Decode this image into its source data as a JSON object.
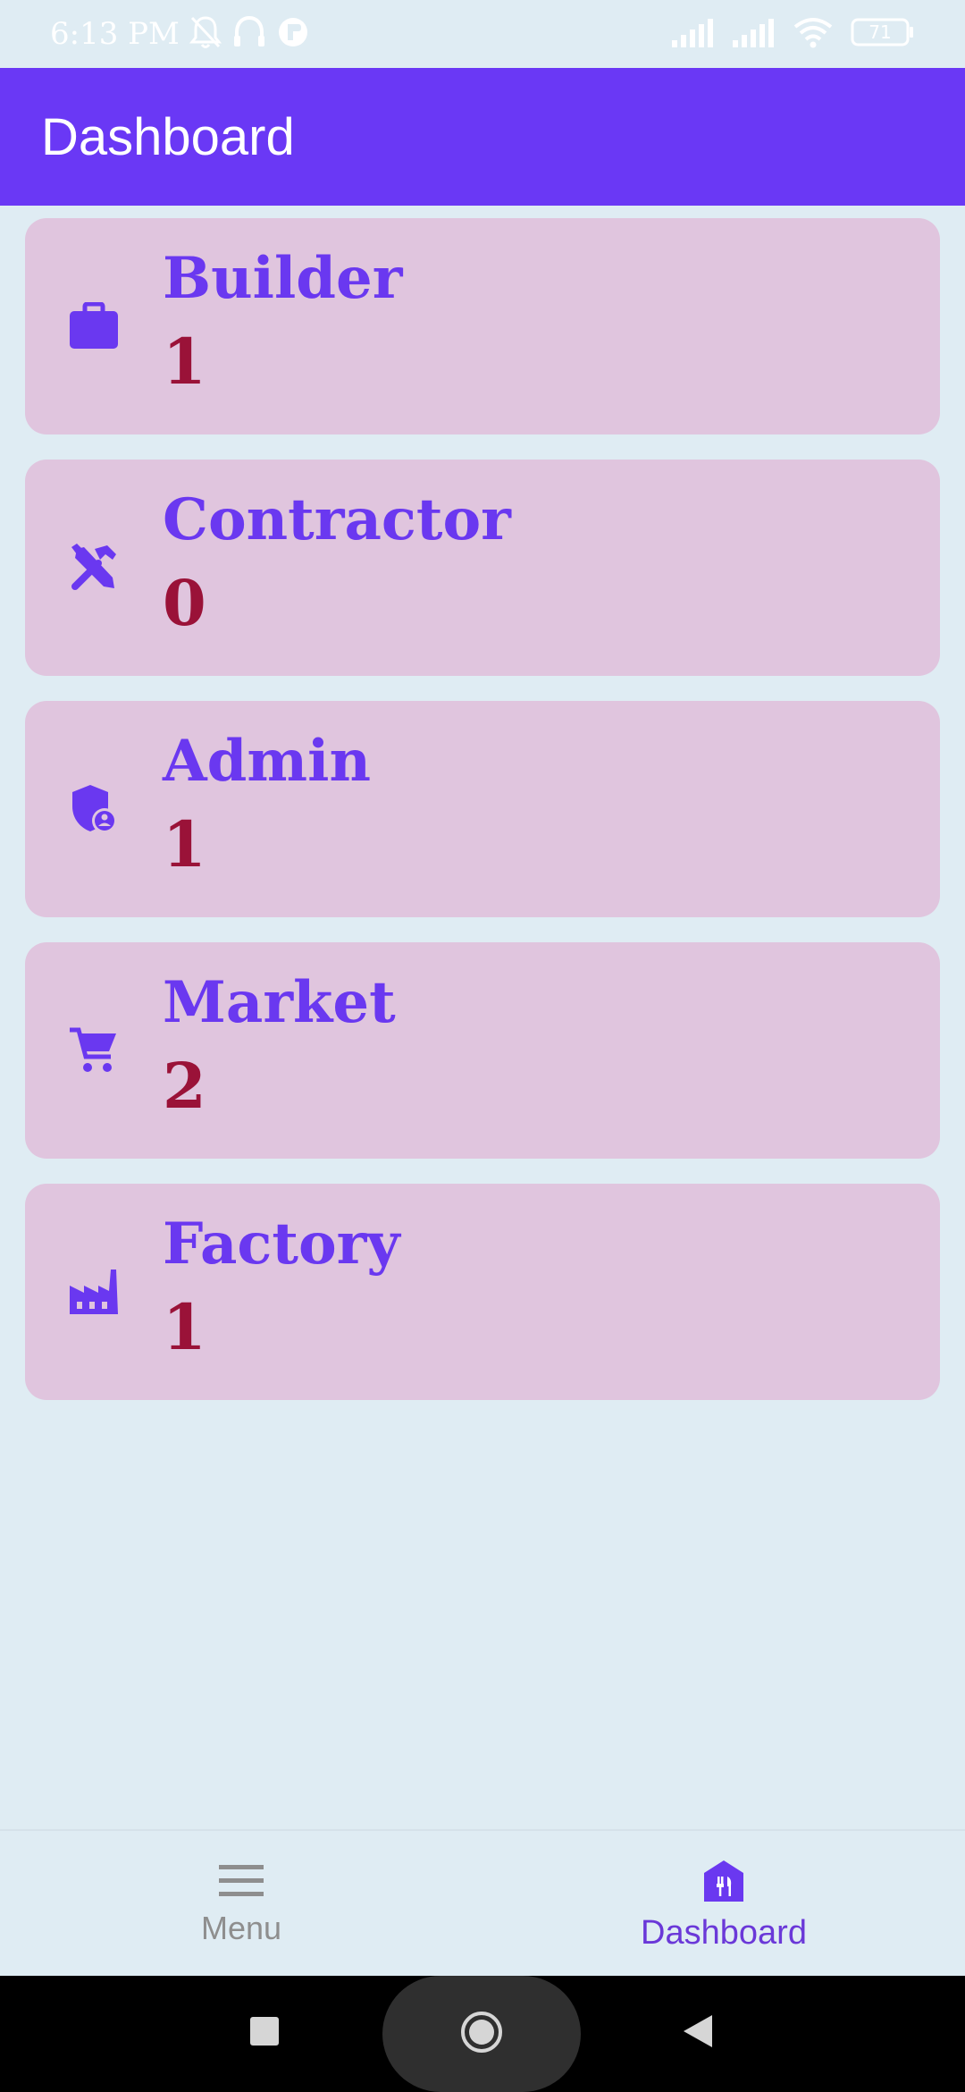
{
  "status_bar": {
    "time": "6:13 PM",
    "battery": "71",
    "icons": [
      "bell-off-icon",
      "headphones-icon",
      "app-notification-icon",
      "signal-icon",
      "signal-icon",
      "wifi-icon",
      "battery-icon"
    ]
  },
  "app_bar": {
    "title": "Dashboard"
  },
  "cards": [
    {
      "title": "Builder",
      "count": "1",
      "icon": "briefcase-icon"
    },
    {
      "title": "Contractor",
      "count": "0",
      "icon": "tools-icon"
    },
    {
      "title": "Admin",
      "count": "1",
      "icon": "admin-shield-icon"
    },
    {
      "title": "Market",
      "count": "2",
      "icon": "cart-icon"
    },
    {
      "title": "Factory",
      "count": "1",
      "icon": "factory-icon"
    }
  ],
  "bottom_nav": {
    "items": [
      {
        "label": "Menu",
        "icon": "menu-icon",
        "active": false
      },
      {
        "label": "Dashboard",
        "icon": "dashboard-home-icon",
        "active": true
      }
    ]
  },
  "colors": {
    "primary": "#6a38f5",
    "card_bg": "#e0c5de",
    "title": "#6a38f0",
    "count": "#9a1238",
    "background": "#dfecf3"
  }
}
